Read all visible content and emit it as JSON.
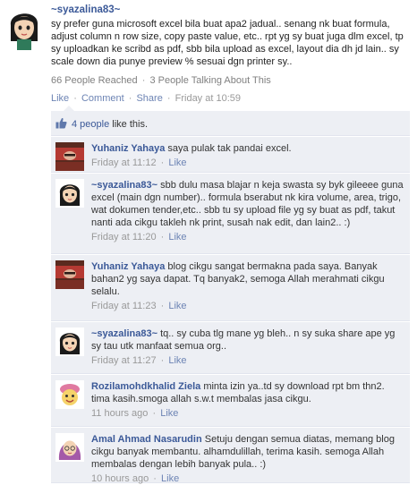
{
  "post": {
    "author": "~syazalina83~",
    "text": "sy prefer guna microsoft excel bila buat apa2 jadual.. senang nk buat formula, adjust column n row size, copy paste value, etc.. rpt yg sy buat juga dlm excel, tp sy uploadkan ke scribd as pdf, sbb bila upload as excel, layout dia dh jd lain.. sy scale down dia punye preview % sesuai dgn printer sy..",
    "reached": "66 People Reached",
    "talking": "3 People Talking About This",
    "actions": {
      "like": "Like",
      "comment": "Comment",
      "share": "Share",
      "time": "Friday at 10:59"
    }
  },
  "likes": {
    "count": "4 people",
    "suffix": "like this."
  },
  "comments": [
    {
      "author": "Yuhaniz Yahaya",
      "text": "saya pulak tak pandai excel.",
      "time": "Friday at 11:12",
      "like": "Like",
      "avatar": "woman-red-scarf-icon"
    },
    {
      "author": "~syazalina83~",
      "text": "sbb dulu masa blajar n keja swasta sy byk gileeee guna excel (main dgn number).. formula bserabut nk kira volume, area, trigo, wat dokumen tender,etc.. sbb tu sy upload file yg sy buat as pdf, takut nanti ada cikgu takleh nk print, susah nak edit, dan lain2.. :)",
      "time": "Friday at 11:20",
      "like": "Like",
      "avatar": "cartoon-girl-icon"
    },
    {
      "author": "Yuhaniz Yahaya",
      "text": "blog cikgu sangat bermakna pada saya. Banyak bahan2 yg saya dapat. Tq banyak2, semoga Allah merahmati cikgu selalu.",
      "time": "Friday at 11:23",
      "like": "Like",
      "avatar": "woman-red-scarf-icon"
    },
    {
      "author": "~syazalina83~",
      "text": "tq.. sy cuba tlg mane yg bleh.. n sy suka share ape yg sy tau utk manfaat semua org..",
      "time": "Friday at 11:27",
      "like": "Like",
      "avatar": "cartoon-girl-icon"
    },
    {
      "author": "Rozilamohdkhalid Ziela",
      "text": "minta izin ya..td sy download rpt bm thn2. tima kasih.smoga allah s.w.t membalas jasa cikgu.",
      "time": "11 hours ago",
      "like": "Like",
      "avatar": "cartoon-smiley-icon"
    },
    {
      "author": "Amal Ahmad Nasarudin",
      "text": "Setuju dengan semua diatas, memang blog cikgu banyak membantu. alhamdulillah, terima kasih. semoga Allah membalas dengan lebih banyak pula.. :)",
      "time": "10 hours ago",
      "like": "Like",
      "avatar": "cartoon-hijab-girl-icon"
    }
  ]
}
